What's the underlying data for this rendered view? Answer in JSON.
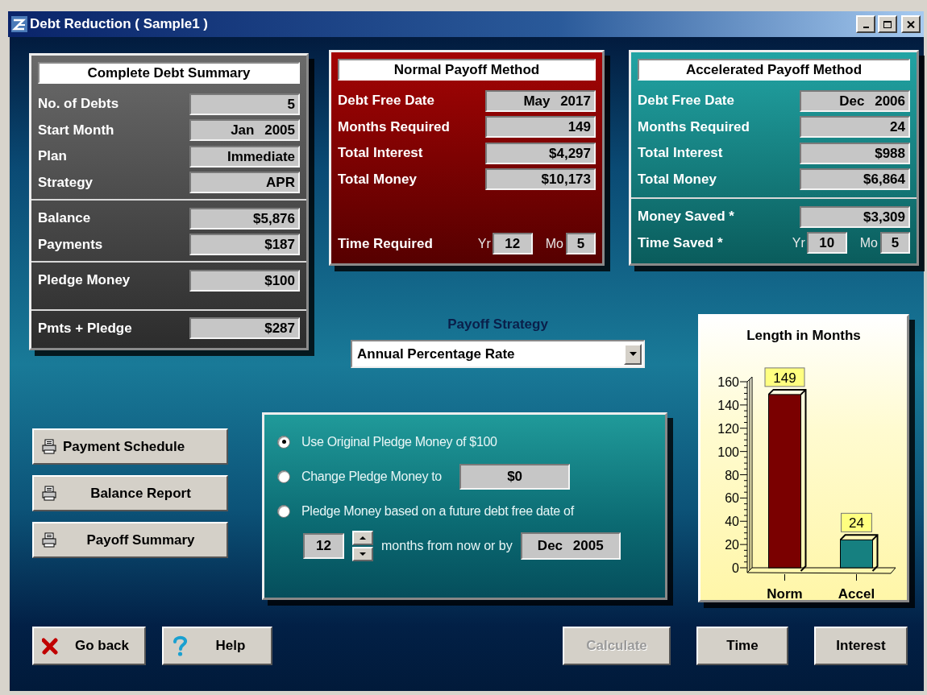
{
  "window": {
    "title": "Debt Reduction ( Sample1 )"
  },
  "summary": {
    "title": "Complete Debt Summary",
    "sections": [
      [
        {
          "label": "No. of Debts",
          "value": "5"
        },
        {
          "label": "Start Month",
          "value": "Jan 2005"
        },
        {
          "label": "Plan",
          "value": "Immediate"
        },
        {
          "label": "Strategy",
          "value": "APR"
        }
      ],
      [
        {
          "label": "Balance",
          "value": "$5,876"
        },
        {
          "label": "Payments",
          "value": "$187"
        }
      ],
      [
        {
          "label": "Pledge Money",
          "value": "$100"
        }
      ],
      [
        {
          "label": "Pmts + Pledge",
          "value": "$287"
        }
      ]
    ]
  },
  "normal": {
    "title": "Normal Payoff Method",
    "rows": [
      {
        "label": "Debt Free Date",
        "value": "May 2017"
      },
      {
        "label": "Months Required",
        "value": "149"
      },
      {
        "label": "Total Interest",
        "value": "$4,297"
      },
      {
        "label": "Total Money",
        "value": "$10,173"
      }
    ],
    "time": {
      "label": "Time Required",
      "yr_label": "Yr",
      "yr": "12",
      "mo_label": "Mo",
      "mo": "5"
    }
  },
  "accelerated": {
    "title": "Accelerated Payoff Method",
    "rows": [
      {
        "label": "Debt Free Date",
        "value": "Dec 2006"
      },
      {
        "label": "Months Required",
        "value": "24"
      },
      {
        "label": "Total Interest",
        "value": "$988"
      },
      {
        "label": "Total Money",
        "value": "$6,864"
      }
    ],
    "savings": [
      {
        "label": "Money Saved *",
        "value": "$3,309"
      }
    ],
    "time": {
      "label": "Time Saved *",
      "yr_label": "Yr",
      "yr": "10",
      "mo_label": "Mo",
      "mo": "5"
    }
  },
  "payoff_strategy": {
    "label": "Payoff Strategy",
    "value": "Annual Percentage Rate"
  },
  "report_buttons": [
    "Payment Schedule",
    "Balance Report",
    "Payoff Summary"
  ],
  "pledge_options": [
    {
      "kind": "plain",
      "label": "Use Original Pledge Money of $100",
      "selected": true
    },
    {
      "kind": "amount",
      "label": "Change Pledge Money to",
      "value": "$0",
      "selected": false
    },
    {
      "kind": "date",
      "label": "Pledge Money based on a future debt free date of",
      "selected": false,
      "months": "12",
      "months_text": "months from now or by",
      "date": "Dec 2005"
    }
  ],
  "chart": {
    "chart_data": {
      "type": "bar",
      "title": "Length in Months",
      "categories": [
        "Norm",
        "Accel"
      ],
      "series": [
        {
          "values": [
            149,
            24
          ],
          "colors": [
            "#7a0000",
            "#168080"
          ]
        }
      ],
      "ylim": [
        0,
        160
      ],
      "yticks": [
        0,
        20,
        40,
        60,
        80,
        100,
        120,
        140,
        160
      ],
      "data_labels": true
    }
  },
  "bottom_left_buttons": [
    {
      "kind": "close",
      "label": "Go back",
      "disabled": false
    },
    {
      "kind": "help",
      "label": "Help",
      "disabled": false
    }
  ],
  "bottom_right_buttons": [
    {
      "label": "Calculate",
      "disabled": true
    },
    {
      "label": "Time",
      "disabled": false
    },
    {
      "label": "Interest",
      "disabled": false
    }
  ]
}
